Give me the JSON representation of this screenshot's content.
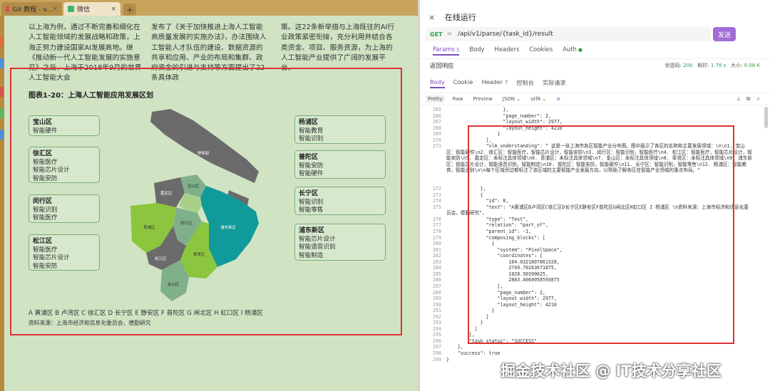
{
  "browser": {
    "tabs": [
      {
        "label": "Git 教程 - v..."
      },
      {
        "label": "微信"
      }
    ],
    "new_tab": "+"
  },
  "document": {
    "col1": "以上海为例，通过不断完善和细化在人工智能领域的发展战略和政策，上海正努力建设国家AI发展高地。继《推动新一代人工智能发展的实施意见》之后，上海于2018年9月的世界人工智能大会",
    "col2": "发布了《关于加快推进上海人工智能高质量发展的实施办法》，办法围绕人工智能人才队伍的建设、数据资源的共享和应用、产业的布局和集群、政府资金的引进与支持等方面提出了22条具体政",
    "col3": "策。这22条新举措与上海既往的AI行业政策紧密衔接，充分利用并结合各类资金、项目、服务资源，为上海的人工智能产业提供了广阔的发展平台。",
    "figure_title": "图表1-20：上海人工智能应用发展区划",
    "left_districts": [
      {
        "name": "宝山区",
        "lines": [
          "智能硬件"
        ]
      },
      {
        "name": "徐汇区",
        "lines": [
          "智能医疗",
          "智能芯片设计",
          "智能安防"
        ]
      },
      {
        "name": "闵行区",
        "lines": [
          "智能识别",
          "智能医疗"
        ]
      },
      {
        "name": "松江区",
        "lines": [
          "智能医疗",
          "智能芯片设计",
          "智能安防"
        ]
      }
    ],
    "right_districts": [
      {
        "name": "杨浦区",
        "lines": [
          "智能教育",
          "智能识别"
        ]
      },
      {
        "name": "普陀区",
        "lines": [
          "智能安防",
          "智能硬件"
        ]
      },
      {
        "name": "长宁区",
        "lines": [
          "智能识别",
          "智能零售"
        ]
      },
      {
        "name": "浦东新区",
        "lines": [
          "智能芯片设计",
          "智能语音识别",
          "智能制造"
        ]
      }
    ],
    "map_labels": {
      "chongming": "崇明县",
      "baoshan": "宝山区",
      "jiading": "嘉定区",
      "qingpu": "青浦区",
      "songjiang": "松江区",
      "minhang": "闵行区",
      "pudong": "浦东新区",
      "fengxian": "奉贤区",
      "jinshan": "金山区"
    },
    "legend": "A 黄浦区  B 卢湾区  C 徐汇区  D 长宁区  E 静安区  F 普陀区  G 闸北区  H 虹口区  I 杨浦区",
    "source": "资料来源：上海市经济和信息化委员会，德勤研究"
  },
  "panel": {
    "close": "×",
    "title": "在线运行",
    "method": "GET",
    "url": "/api/v1/parse/{task_id}/result",
    "send": "发送",
    "req_tabs": [
      "Params",
      "Body",
      "Headers",
      "Cookies",
      "Auth"
    ],
    "params_count": "1",
    "response_label": "返回响应",
    "status_label": "状态码:",
    "status_value": "200",
    "time_label": "耗时:",
    "time_value": "1.76 s",
    "size_label": "大小:",
    "size_value": "9.08 K",
    "resp_tabs": [
      "Body",
      "Cookie",
      "Header",
      "控制台",
      "实际请求"
    ],
    "header_count": "7",
    "toolbar": [
      "Pretty",
      "Raw",
      "Preview",
      "JSON",
      "utf8"
    ],
    "code_lines": [
      {
        "n": "265",
        "t": "                    },"
      },
      {
        "n": "266",
        "t": "                    \"page_number\": 2,"
      },
      {
        "n": "267",
        "t": "                    \"layout_width\": 2977,"
      },
      {
        "n": "268",
        "t": "                    \"layout_height\": 4210"
      },
      {
        "n": "269",
        "t": "                  }"
      },
      {
        "n": "270",
        "t": "              ],"
      },
      {
        "n": "271",
        "t": "              \"vlm_understanding\": \" 这是一张上海市各区智能产业分布图。图中展示了各区的名称和主要发展领域：\\n\\n1. 宝山区：智能硬件\\n2. 徐汇区：智能医疗，智能芯片设计，智能安防\\n3. 闵行区：智能识别，智能医疗\\n4. 松江区：智能医疗，智能芯片设计，智能安防\\n5. 嘉定区：未标注具体领域\\n6. 青浦区：未标注具体领域\\n7. 金山区：未标注具体领域\\n8. 奉贤区：未标注具体领域\\n9. 浦东新区：智能芯片设计，智能语音识别，智能制造\\n10. 普陀区：智能安防，智能硬件\\n11. 长宁区：智能识别，智能零售\\n12. 杨浦区：智能教育，智能识别\\n\\n每个区域旁边都标注了该区域的主要智能产业发展方向，以帮助了解各区在智能产业领域的重点布局。\""
      },
      {
        "n": "272",
        "t": "            },"
      },
      {
        "n": "273",
        "t": "            {"
      },
      {
        "n": "274",
        "t": "              \"id\": 8,"
      },
      {
        "n": "275",
        "t": "              \"text\": \"A黄浦区B卢湾区C徐汇区D长宁区E静安区F普陀区G闸北区H虹口区 I 杨浦区 \\n资料来源：上海市经济和信息化委员会，德勤研究\","
      },
      {
        "n": "276",
        "t": "              \"type\": \"Text\","
      },
      {
        "n": "277",
        "t": "              \"relation\": \"part_of\","
      },
      {
        "n": "278",
        "t": "              \"parent_id\": -1,"
      },
      {
        "n": "279",
        "t": "              \"composing_blocks\": ["
      },
      {
        "n": "280",
        "t": "                {"
      },
      {
        "n": "281",
        "t": "                  \"system\": \"PixelSpace\","
      },
      {
        "n": "282",
        "t": "                  \"coordinates\": ["
      },
      {
        "n": "283",
        "t": "                      164.0321807861328,"
      },
      {
        "n": "284",
        "t": "                      2749.70263671875,"
      },
      {
        "n": "285",
        "t": "                      1028.50390625,"
      },
      {
        "n": "286",
        "t": "                      2883.4060058593875"
      },
      {
        "n": "287",
        "t": "                  ],"
      },
      {
        "n": "288",
        "t": "                  \"page_number\": 2,"
      },
      {
        "n": "289",
        "t": "                  \"layout_width\": 2977,"
      },
      {
        "n": "290",
        "t": "                  \"layout_height\": 4210"
      },
      {
        "n": "291",
        "t": "                }"
      },
      {
        "n": "292",
        "t": "              ]"
      },
      {
        "n": "293",
        "t": "            }"
      },
      {
        "n": "294",
        "t": "          ]"
      },
      {
        "n": "295",
        "t": "        },"
      },
      {
        "n": "296",
        "t": "        \"task_status\": \"SUCCESS\""
      },
      {
        "n": "297",
        "t": "    },"
      },
      {
        "n": "298",
        "t": "    \"success\": true"
      },
      {
        "n": "299",
        "t": "}"
      }
    ]
  },
  "watermark": "掘金技术社区 @ IT技术分享社区",
  "colors": {
    "accent": "#7b4fbd",
    "send": "#a06cd5",
    "get": "#2fa34a",
    "highlight_box": "#dd3333",
    "doc_bg": "#d0e4c4",
    "map_dark": "#6b6b6b",
    "map_lime": "#8cc63f",
    "map_teal": "#119a9a",
    "map_sage": "#7fb08a"
  }
}
